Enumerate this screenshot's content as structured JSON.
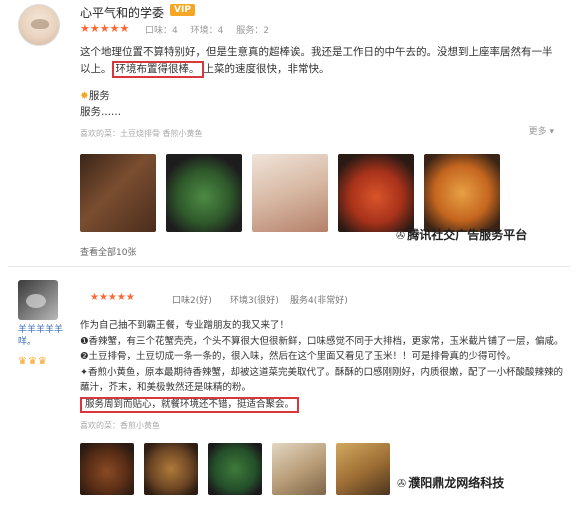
{
  "review1": {
    "username": "心平气和的学委",
    "vip_label": "VIP",
    "stars": "★★★★★",
    "scores": [
      "口味：4",
      "环境：4",
      "服务：2"
    ],
    "text_part1": "这个地理位置不算特别好，但是生意真的超棒诶。我还是工作日的中午去的。没想到上座率居然有一半以上。",
    "highlight": "环境布置得很棒。",
    "text_part2": "上菜的速度很快，非常快。",
    "service_title": "服务",
    "service_text": "服务......",
    "favorites": "喜欢的菜：土豆烧排骨  香煎小黄鱼",
    "more": "更多 ▾",
    "see_all_photos": "查看全部10张",
    "watermark": "腾讯社交广告服务平台",
    "photo_colors": [
      "#5a3a28",
      "#3d6b3a",
      "#e8d6c9",
      "#c2431e",
      "#d68a2f"
    ]
  },
  "review2": {
    "username": "羊羊羊羊羊咩。",
    "badges": "♛♛♛",
    "stars": "★★★★★",
    "scores": [
      "口味2(好)",
      "环境3(很好)",
      "服务4(非常好)"
    ],
    "lines": [
      "作为自己抽不到霸王餐，专业蹭朋友的我又来了！",
      "❶香辣蟹，有三个花蟹壳壳，个头不算很大但很新鲜，口味感觉不同于大排档，更家常，玉米截片铺了一层，偏咸。",
      "❷土豆排骨，土豆切成一条一条的，很入味，然后在这个里面又看见了玉米！！可是排骨真的少得可怜。",
      "✦香煎小黄鱼，原本最期待香辣蟹，却被这道菜完美取代了。酥酥的口感刚刚好，内质很嫩，配了一小杯酸酸辣辣的蘸汁，芥末，和美极敦然还是味精的粉。"
    ],
    "highlight": "服务周到而贴心，就餐环境还不错，挺适合聚会。",
    "favorites": "喜欢的菜：香煎小黄鱼",
    "watermark": "濮阳鼎龙网络科技",
    "photo_colors": [
      "#6b3b1f",
      "#8a5a2a",
      "#2f5a2e",
      "#c9b79c",
      "#a8824a"
    ]
  }
}
